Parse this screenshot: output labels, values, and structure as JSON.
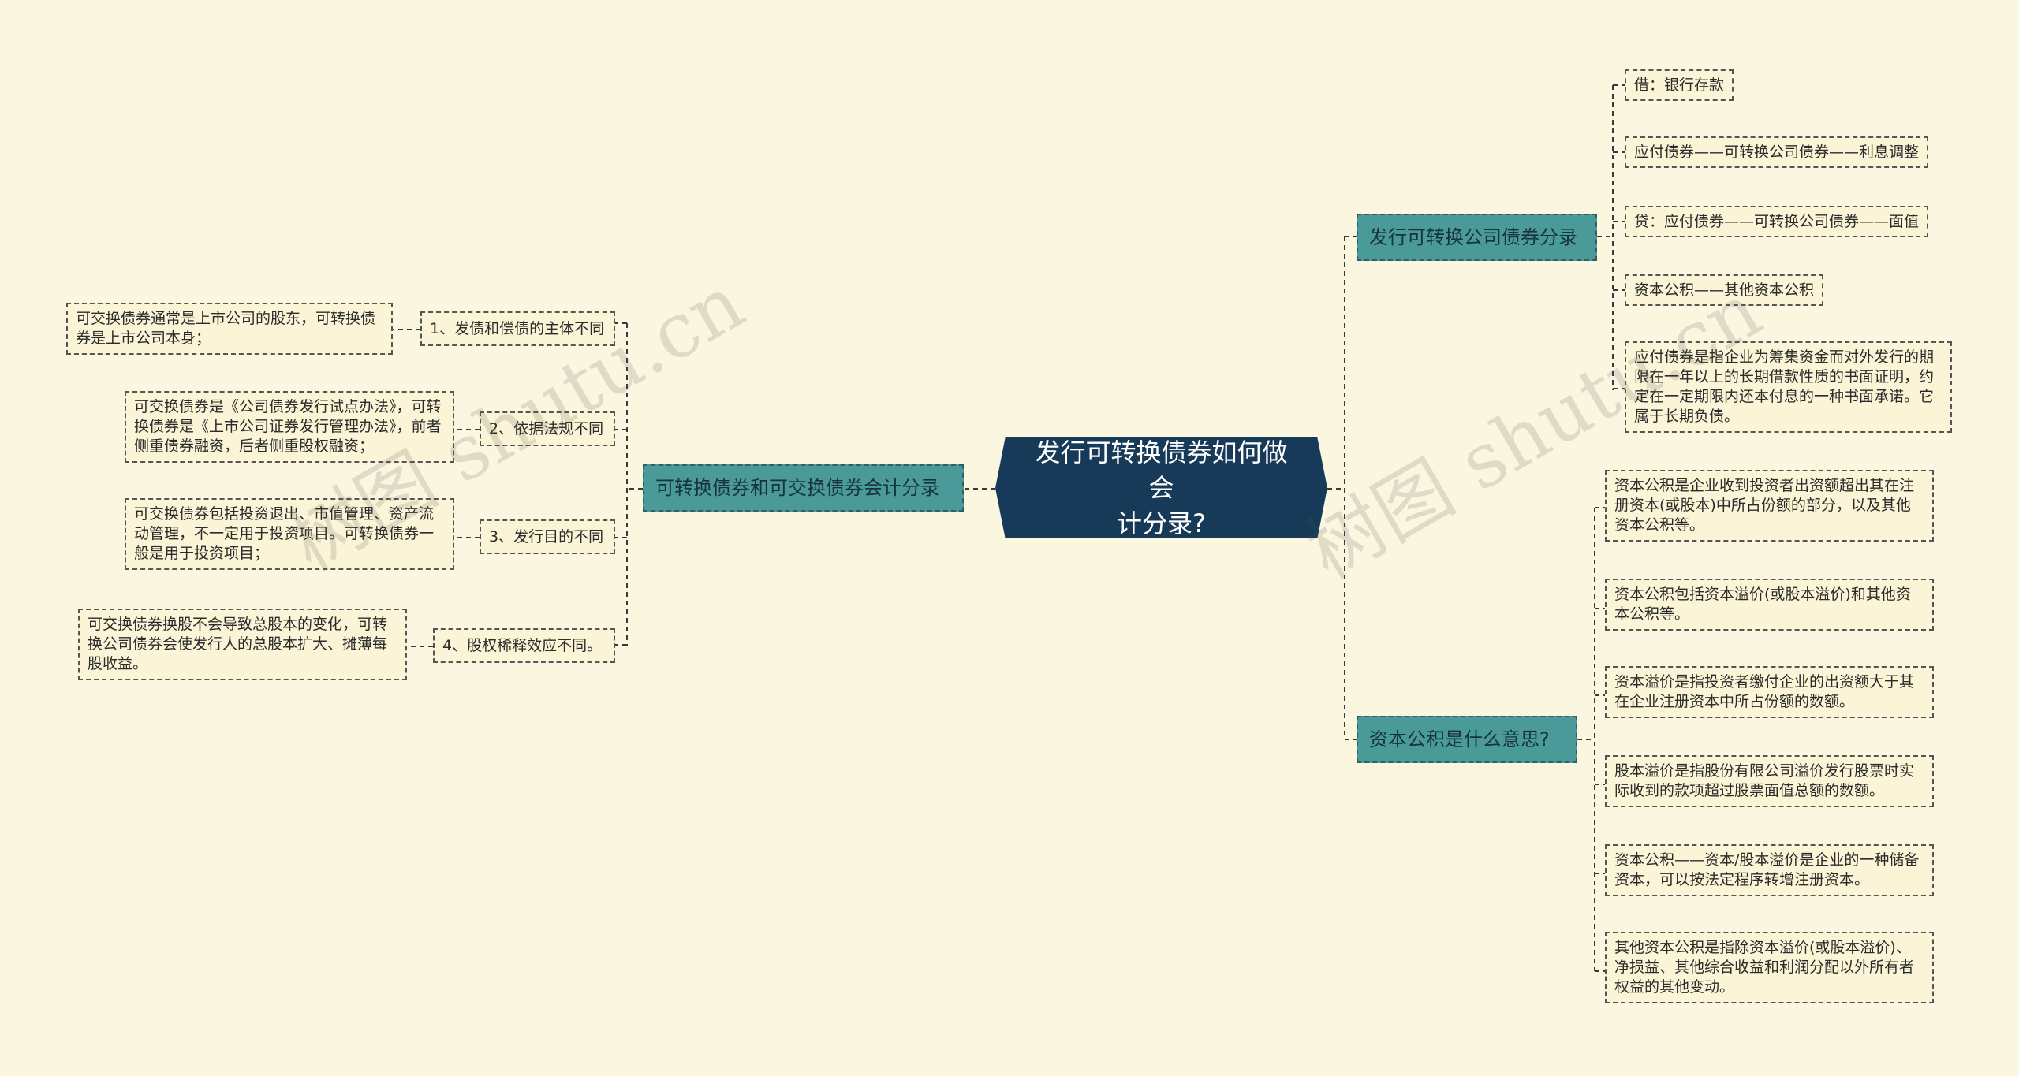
{
  "root": {
    "line1": "发行可转换债券如何做会",
    "line2": "计分录?"
  },
  "left": {
    "branch": "可转换债券和可交换债券会计分录",
    "items": [
      {
        "label": "1、发债和偿债的主体不同",
        "detail": "可交换债券通常是上市公司的股东，可转换债券是上市公司本身；"
      },
      {
        "label": "2、依据法规不同",
        "detail": "可交换债券是《公司债券发行试点办法》，可转换债券是《上市公司证券发行管理办法》，前者侧重债券融资，后者侧重股权融资；"
      },
      {
        "label": "3、发行目的不同",
        "detail": "可交换债券包括投资退出、市值管理、资产流动管理，不一定用于投资项目。可转换债券一般是用于投资项目；"
      },
      {
        "label": "4、股权稀释效应不同。",
        "detail": "可交换债券换股不会导致总股本的变化，可转换公司债券会使发行人的总股本扩大、摊薄每股收益。"
      }
    ]
  },
  "right_top": {
    "branch": "发行可转换公司债券分录",
    "items": [
      "借：银行存款",
      "应付债券——可转换公司债券——利息调整",
      "贷：应付债券——可转换公司债券——面值",
      "资本公积——其他资本公积",
      "应付债券是指企业为筹集资金而对外发行的期限在一年以上的长期借款性质的书面证明，约定在一定期限内还本付息的一种书面承诺。它属于长期负债。"
    ]
  },
  "right_bottom": {
    "branch": "资本公积是什么意思?",
    "items": [
      "资本公积是企业收到投资者出资额超出其在注册资本(或股本)中所占份额的部分，以及其他资本公积等。",
      "资本公积包括资本溢价(或股本溢价)和其他资本公积等。",
      "资本溢价是指投资者缴付企业的出资额大于其在企业注册资本中所占份额的数额。",
      "股本溢价是指股份有限公司溢价发行股票时实际收到的款项超过股票面值总额的数额。",
      "资本公积——资本/股本溢价是企业的一种储备资本，可以按法定程序转增注册资本。",
      "其他资本公积是指除资本溢价(或股本溢价)、净损益、其他综合收益和利润分配以外所有者权益的其他变动。"
    ]
  },
  "watermark": "树图 shutu.cn",
  "colors": {
    "background": "#fbf6df",
    "root": "#173a59",
    "branch": "#4a9a9a",
    "leaf": "#fbf4d6"
  }
}
